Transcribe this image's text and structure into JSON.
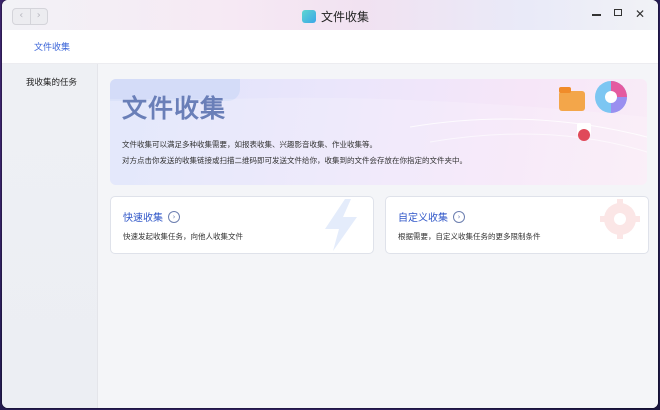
{
  "window": {
    "title": "文件收集",
    "nav_back": "‹",
    "nav_forward": "›",
    "close_glyph": "✕"
  },
  "topnav": {
    "active_tab": "文件收集"
  },
  "sidebar": {
    "items": [
      {
        "label": "我收集的任务"
      }
    ]
  },
  "banner": {
    "title": "文件收集",
    "description_line1": "文件收集可以满足多种收集需要，如报表收集、兴趣影音收集、作业收集等。",
    "description_line2": "对方点击你发送的收集链接或扫描二维码即可发送文件给你，收集到的文件会存放在你指定的文件夹中。"
  },
  "cards": [
    {
      "title": "快速收集",
      "description": "快速发起收集任务，向他人收集文件",
      "icon": "lightning-icon"
    },
    {
      "title": "自定义收集",
      "description": "根据需要，自定义收集任务的更多限制条件",
      "icon": "gear-icon"
    }
  ],
  "colors": {
    "accent": "#2f56c8",
    "banner_title": "#6a7fb8"
  }
}
